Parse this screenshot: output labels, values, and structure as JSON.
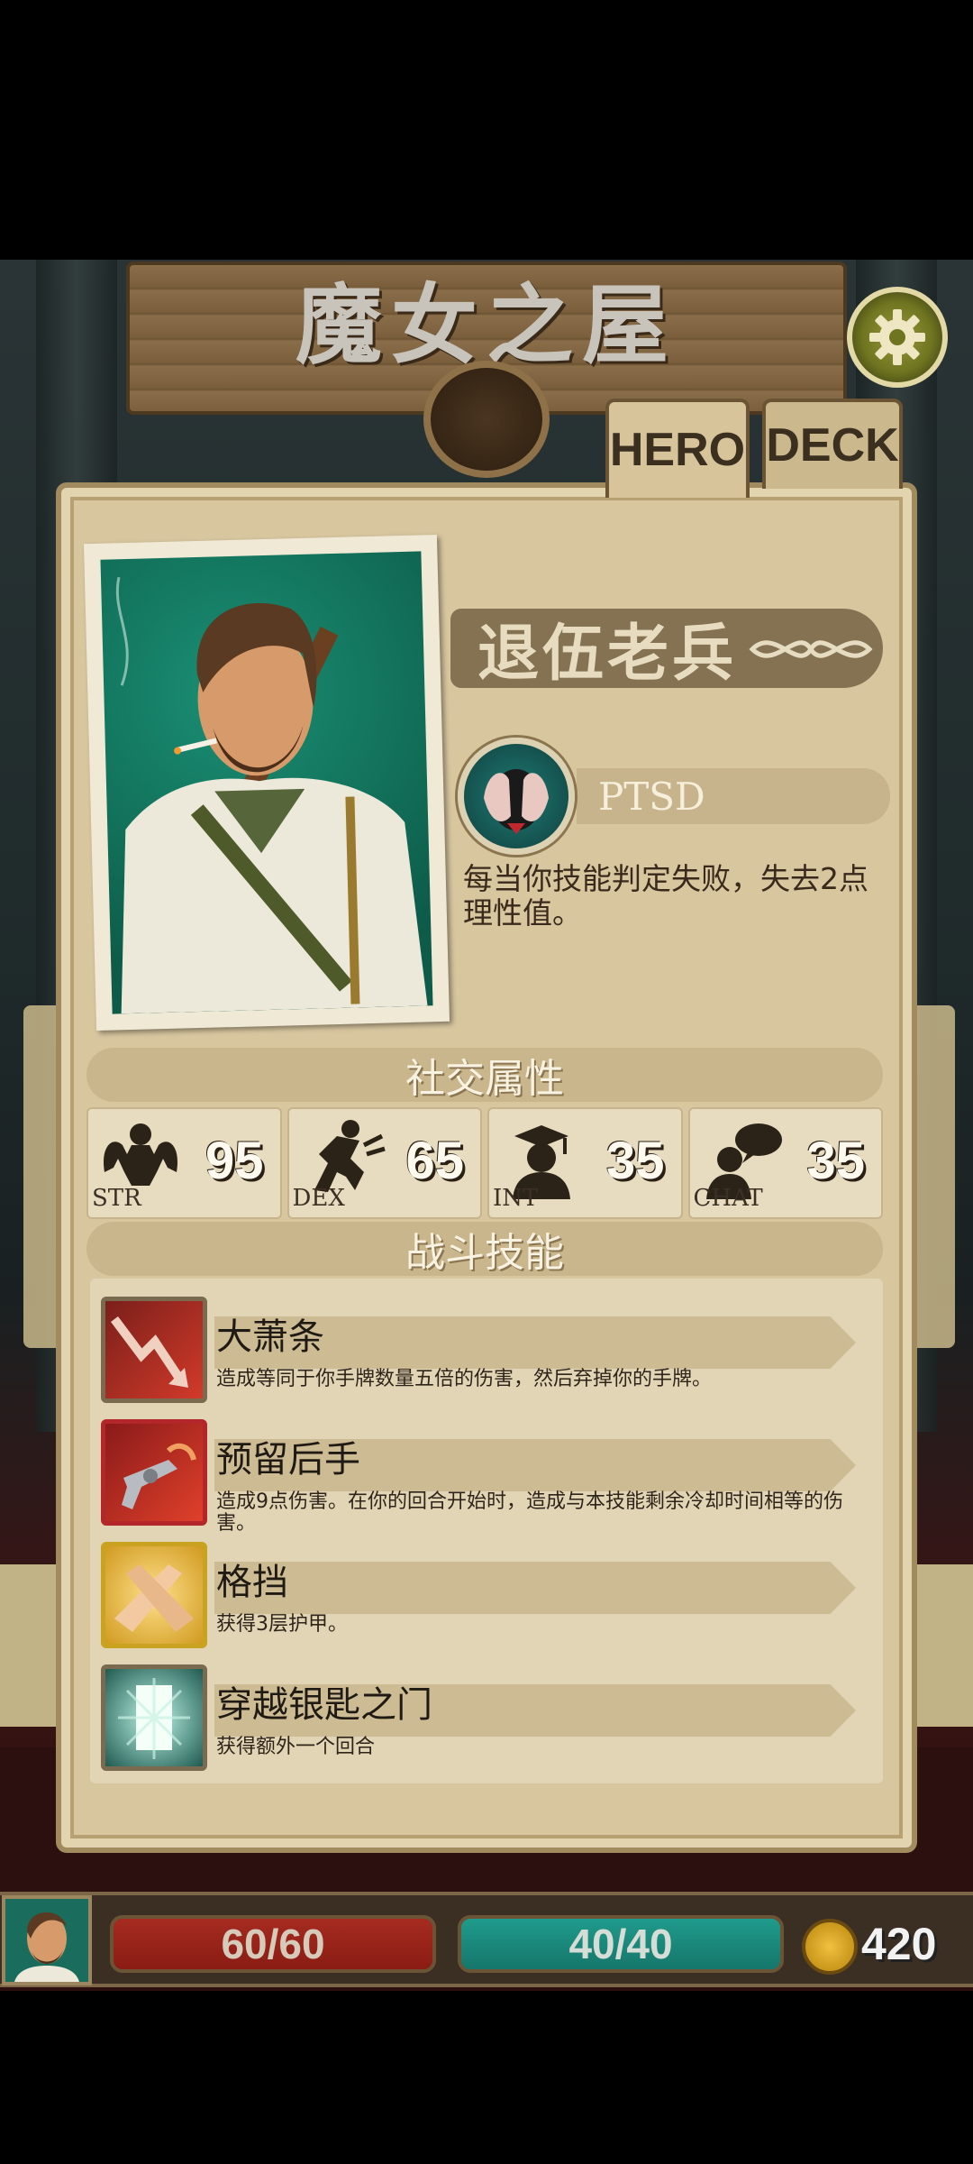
{
  "header": {
    "title": "魔女之屋",
    "settings_icon": "gear-icon"
  },
  "tabs": [
    {
      "label": "HERO",
      "active": true
    },
    {
      "label": "DECK",
      "active": false
    }
  ],
  "hero": {
    "name": "退伍老兵",
    "trait": {
      "name": "PTSD",
      "icon": "head-in-hands-icon",
      "description": "每当你技能判定失败，失去2点理性值。"
    }
  },
  "sections": {
    "social": "社交属性",
    "combat": "战斗技能"
  },
  "stats": [
    {
      "abbr": "STR",
      "value": "95",
      "icon": "muscle-icon"
    },
    {
      "abbr": "DEX",
      "value": "65",
      "icon": "running-icon"
    },
    {
      "abbr": "INT",
      "value": "35",
      "icon": "scholar-icon"
    },
    {
      "abbr": "CHAT",
      "value": "35",
      "icon": "speech-icon"
    }
  ],
  "skills": [
    {
      "title": "大萧条",
      "description": "造成等同于你手牌数量五倍的伤害，然后弃掉你的手牌。",
      "icon": "downtrend-arrow-icon",
      "border_color": "#7a6b50"
    },
    {
      "title": "预留后手",
      "description": "造成9点伤害。在你的回合开始时，造成与本技能剩余冷却时间相等的伤害。",
      "icon": "revolver-icon",
      "border_color": "#b3262a"
    },
    {
      "title": "格挡",
      "description": "获得3层护甲。",
      "icon": "crossed-arms-icon",
      "border_color": "#c9a21f"
    },
    {
      "title": "穿越银匙之门",
      "description": "获得额外一个回合",
      "icon": "portal-door-icon",
      "border_color": "#7a6b50"
    }
  ],
  "hud": {
    "hp": "60/60",
    "sanity": "40/40",
    "gold": "420",
    "coin_icon": "coin-icon"
  },
  "colors": {
    "parchment": "#d8c69f",
    "hp_red": "#a52b20",
    "sanity_teal": "#1f9b8c",
    "gold_coin": "#f0c040"
  }
}
